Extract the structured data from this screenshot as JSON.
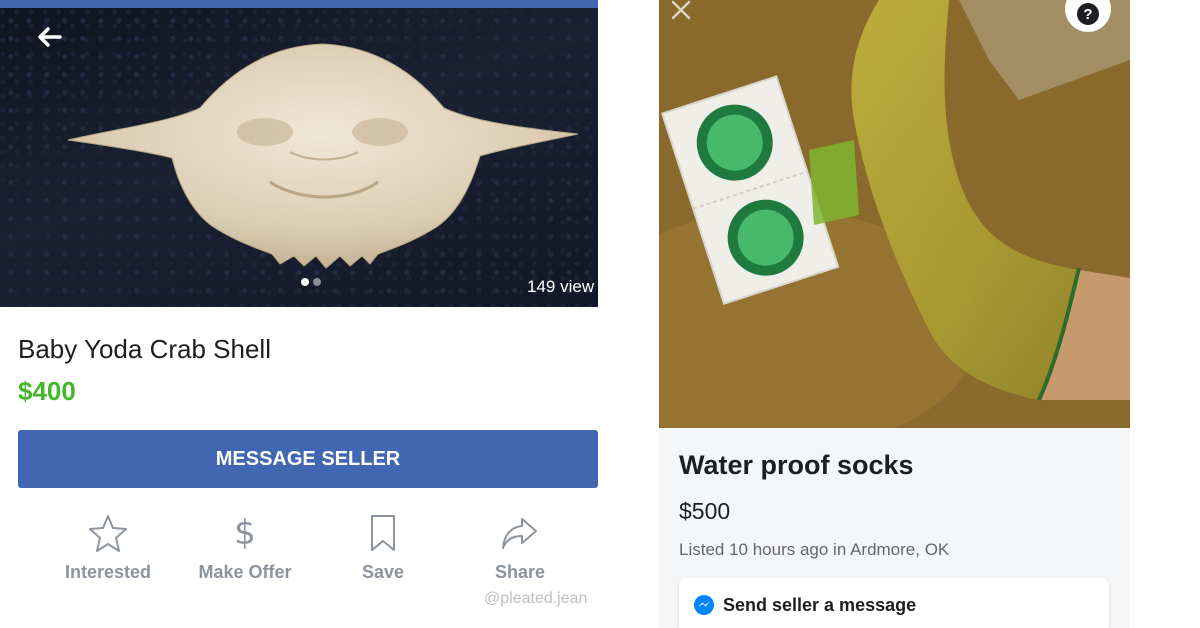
{
  "left_listing": {
    "views_text": "149 view",
    "title": "Baby Yoda Crab Shell",
    "price": "$400",
    "message_button_label": "MESSAGE SELLER",
    "actions": [
      {
        "label": "Interested",
        "icon": "star-icon"
      },
      {
        "label": "Make Offer",
        "icon": "dollar-icon"
      },
      {
        "label": "Save",
        "icon": "bookmark-icon"
      },
      {
        "label": "Share",
        "icon": "share-icon"
      }
    ],
    "watermark": "@pleated.jean",
    "carousel": {
      "total": 2,
      "active": 1
    }
  },
  "right_listing": {
    "help_symbol": "?",
    "title": "Water proof socks",
    "price": "$500",
    "listed_meta": "Listed 10 hours ago in Ardmore, OK",
    "send_message_label": "Send seller a message"
  },
  "colors": {
    "facebook_blue": "#4267b2",
    "price_green": "#42b72a",
    "messenger_blue": "#0084ff"
  }
}
